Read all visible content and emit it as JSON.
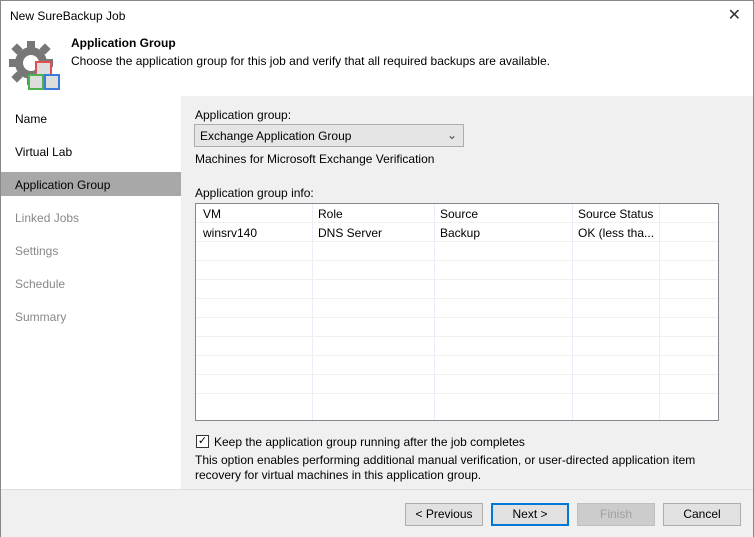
{
  "window": {
    "title": "New SureBackup Job"
  },
  "header": {
    "title": "Application Group",
    "description": "Choose the application group for this job and verify that all required backups are available."
  },
  "sidebar": {
    "items": [
      {
        "label": "Name"
      },
      {
        "label": "Virtual Lab"
      },
      {
        "label": "Application Group"
      },
      {
        "label": "Linked Jobs"
      },
      {
        "label": "Settings"
      },
      {
        "label": "Schedule"
      },
      {
        "label": "Summary"
      }
    ]
  },
  "main": {
    "group_label": "Application group:",
    "group_value": "Exchange Application Group",
    "group_desc": "Machines for Microsoft Exchange Verification",
    "info_label": "Application group info:",
    "columns": [
      "VM",
      "Role",
      "Source",
      "Source Status"
    ],
    "rows": [
      [
        "winsrv140",
        "DNS Server",
        "Backup",
        "OK (less tha..."
      ]
    ],
    "keep_running_label": "Keep the application group running after the job completes",
    "keep_running_checked": true,
    "note": "This option enables performing additional manual verification, or user-directed application item recovery for virtual machines in this application group."
  },
  "footer": {
    "previous": "< Previous",
    "next": "Next >",
    "finish": "Finish",
    "cancel": "Cancel"
  }
}
